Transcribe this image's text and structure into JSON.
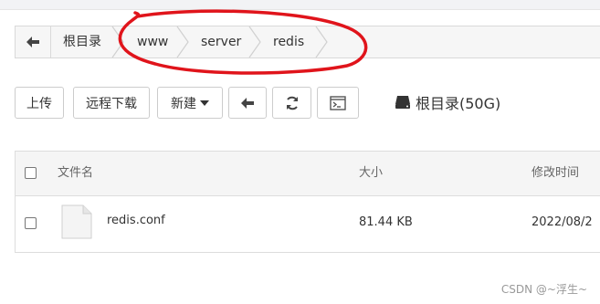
{
  "breadcrumb": {
    "root": "根目录",
    "segments": [
      "www",
      "server",
      "redis"
    ]
  },
  "toolbar": {
    "upload_label": "上传",
    "remote_download_label": "远程下载",
    "new_label": "新建",
    "back_icon": "arrow-left-icon",
    "refresh_icon": "refresh-icon",
    "terminal_icon": "terminal-icon"
  },
  "disk": {
    "label": "根目录(50G)",
    "icon": "disk-icon"
  },
  "table": {
    "columns": [
      "文件名",
      "大小",
      "修改时间"
    ],
    "rows": [
      {
        "name": "redis.conf",
        "size": "81.44 KB",
        "modified": "2022/08/2"
      }
    ]
  },
  "watermark": "CSDN @~浮生~",
  "colors": {
    "annotation_red": "#e0141b"
  }
}
